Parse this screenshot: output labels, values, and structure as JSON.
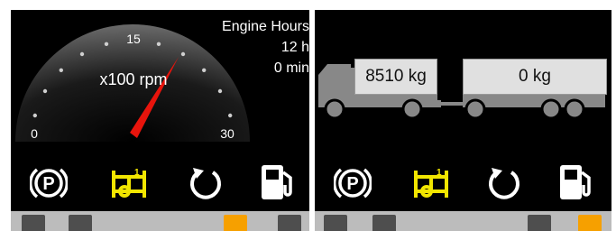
{
  "left_screen": {
    "gauge": {
      "unit_label": "x100 rpm",
      "tick_min": "0",
      "tick_mid": "15",
      "tick_max": "30",
      "needle_color": "#e8140c"
    },
    "engine_hours": {
      "title": "Engine Hours",
      "hours": "12 h",
      "minutes": "0 min"
    },
    "icons": [
      "parking-brake-icon",
      "differential-lock-icon",
      "rotation-arrow-icon",
      "fuel-pump-icon"
    ]
  },
  "right_screen": {
    "truck_weight": "8510 kg",
    "trailer_weight": "0 kg",
    "icons": [
      "parking-brake-icon",
      "differential-lock-icon",
      "rotation-arrow-icon",
      "fuel-pump-icon"
    ]
  },
  "colors": {
    "screen_bg": "#000000",
    "icon_white": "#ffffff",
    "icon_yellow": "#f2e600",
    "key_gray": "#4e4e4e",
    "key_orange": "#f6a000"
  }
}
